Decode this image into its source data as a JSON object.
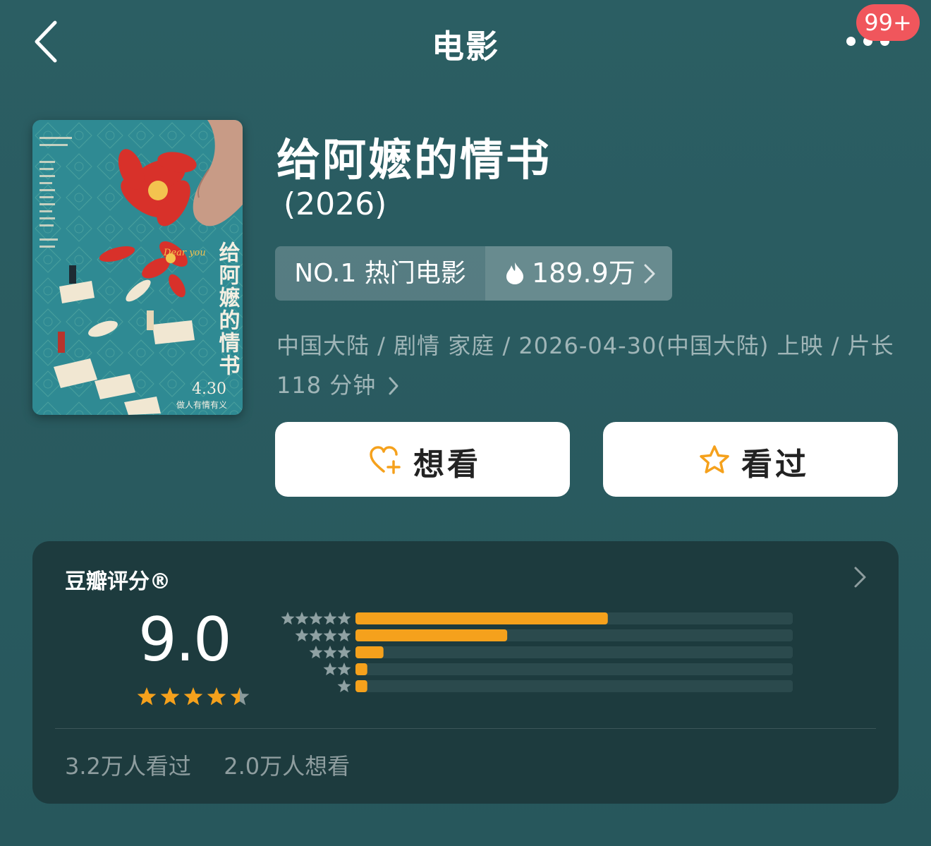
{
  "header": {
    "title": "电影",
    "back_icon": "back-chevron-icon",
    "more_icon": "more-dots-icon",
    "badge": "99+"
  },
  "movie": {
    "title": "给阿嬷的情书",
    "year": "(2026)",
    "rank_label": "NO.1 热门电影",
    "heat_value": "189.9万",
    "meta_line1": "中国大陆 / 剧情 家庭 / 2026-04-30(中国大陆) 上映 / 片长",
    "meta_line2": "118 分钟",
    "poster": {
      "vertical_title": "给阿嬷的情书",
      "dear_you": "Dear you",
      "release": "4.30",
      "slogan": "做人有情有义"
    }
  },
  "actions": {
    "want_label": "想看",
    "watched_label": "看过"
  },
  "rating": {
    "title": "豆瓣评分®",
    "score": "9.0",
    "stars": 4.5,
    "distribution": [
      {
        "stars": 5,
        "fraction": 0.577
      },
      {
        "stars": 4,
        "fraction": 0.347
      },
      {
        "stars": 3,
        "fraction": 0.064
      },
      {
        "stars": 2,
        "fraction": 0.027
      },
      {
        "stars": 1,
        "fraction": 0.027
      }
    ],
    "watched_count": "3.2万人看过",
    "want_count": "2.0万人想看"
  },
  "colors": {
    "accent": "#f5a11c",
    "badge": "#f0565c",
    "card_bg": "#1d3b3e",
    "bg": "#2a5b60"
  }
}
